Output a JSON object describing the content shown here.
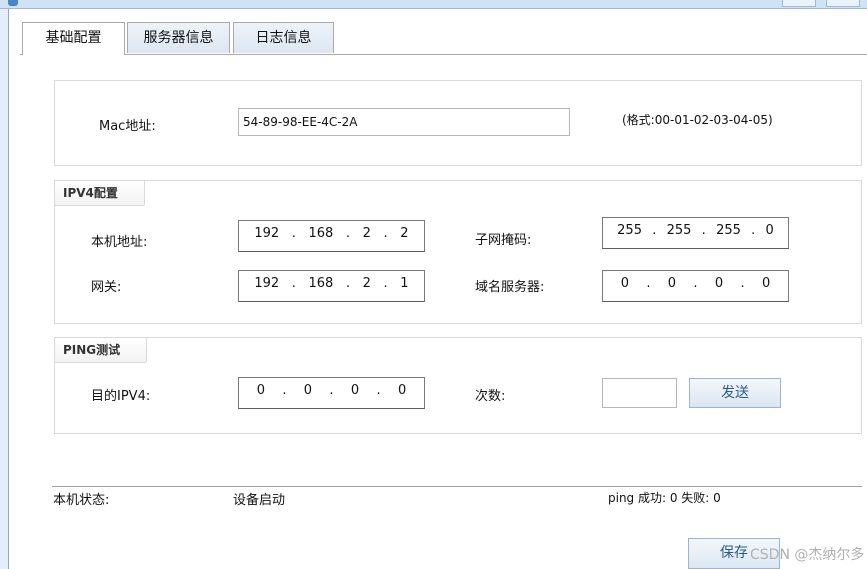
{
  "tabs": [
    "基础配置",
    "服务器信息",
    "日志信息"
  ],
  "mac": {
    "label": "Mac地址:",
    "value": "54-89-98-EE-4C-2A",
    "format_hint": "(格式:00-01-02-03-04-05)"
  },
  "ipv4": {
    "legend": "IPV4配置",
    "local_label": "本机地址:",
    "local_ip": [
      "192",
      "168",
      "2",
      "2"
    ],
    "mask_label": "子网掩码:",
    "mask": [
      "255",
      "255",
      "255",
      "0"
    ],
    "gateway_label": "网关:",
    "gateway": [
      "192",
      "168",
      "2",
      "1"
    ],
    "dns_label": "域名服务器:",
    "dns": [
      "0",
      "0",
      "0",
      "0"
    ]
  },
  "ping": {
    "legend": "PING测试",
    "target_label": "目的IPV4:",
    "target": [
      "0",
      "0",
      "0",
      "0"
    ],
    "count_label": "次数:",
    "count_value": "",
    "send_label": "发送"
  },
  "status": {
    "label": "本机状态:",
    "value": "设备启动",
    "ping_result": "ping 成功: 0 失败: 0"
  },
  "save_label": "保存",
  "watermark": "CSDN @杰纳尔多"
}
